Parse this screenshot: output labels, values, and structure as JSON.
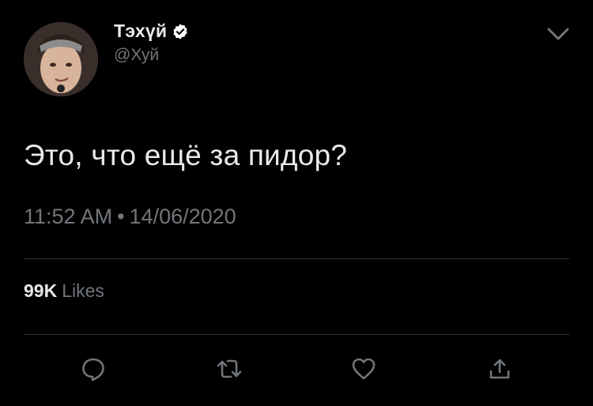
{
  "user": {
    "display_name": "Тэхүй",
    "handle": "@Хуй",
    "verified": true
  },
  "tweet": {
    "text": "Это, что ещё за пидор?",
    "time": "11:52 AM",
    "separator": "•",
    "date": "14/06/2020"
  },
  "stats": {
    "likes_count": "99K",
    "likes_label": "Likes"
  },
  "icons": {
    "avatar": "profile-photo",
    "verified": "verified-badge-icon",
    "menu": "chevron-down-icon",
    "reply": "reply-icon",
    "retweet": "retweet-icon",
    "like": "heart-icon",
    "share": "share-icon"
  },
  "colors": {
    "background": "#000000",
    "primary_text": "#e7e9ea",
    "secondary_text": "#71767b",
    "divider": "#2f3336"
  }
}
